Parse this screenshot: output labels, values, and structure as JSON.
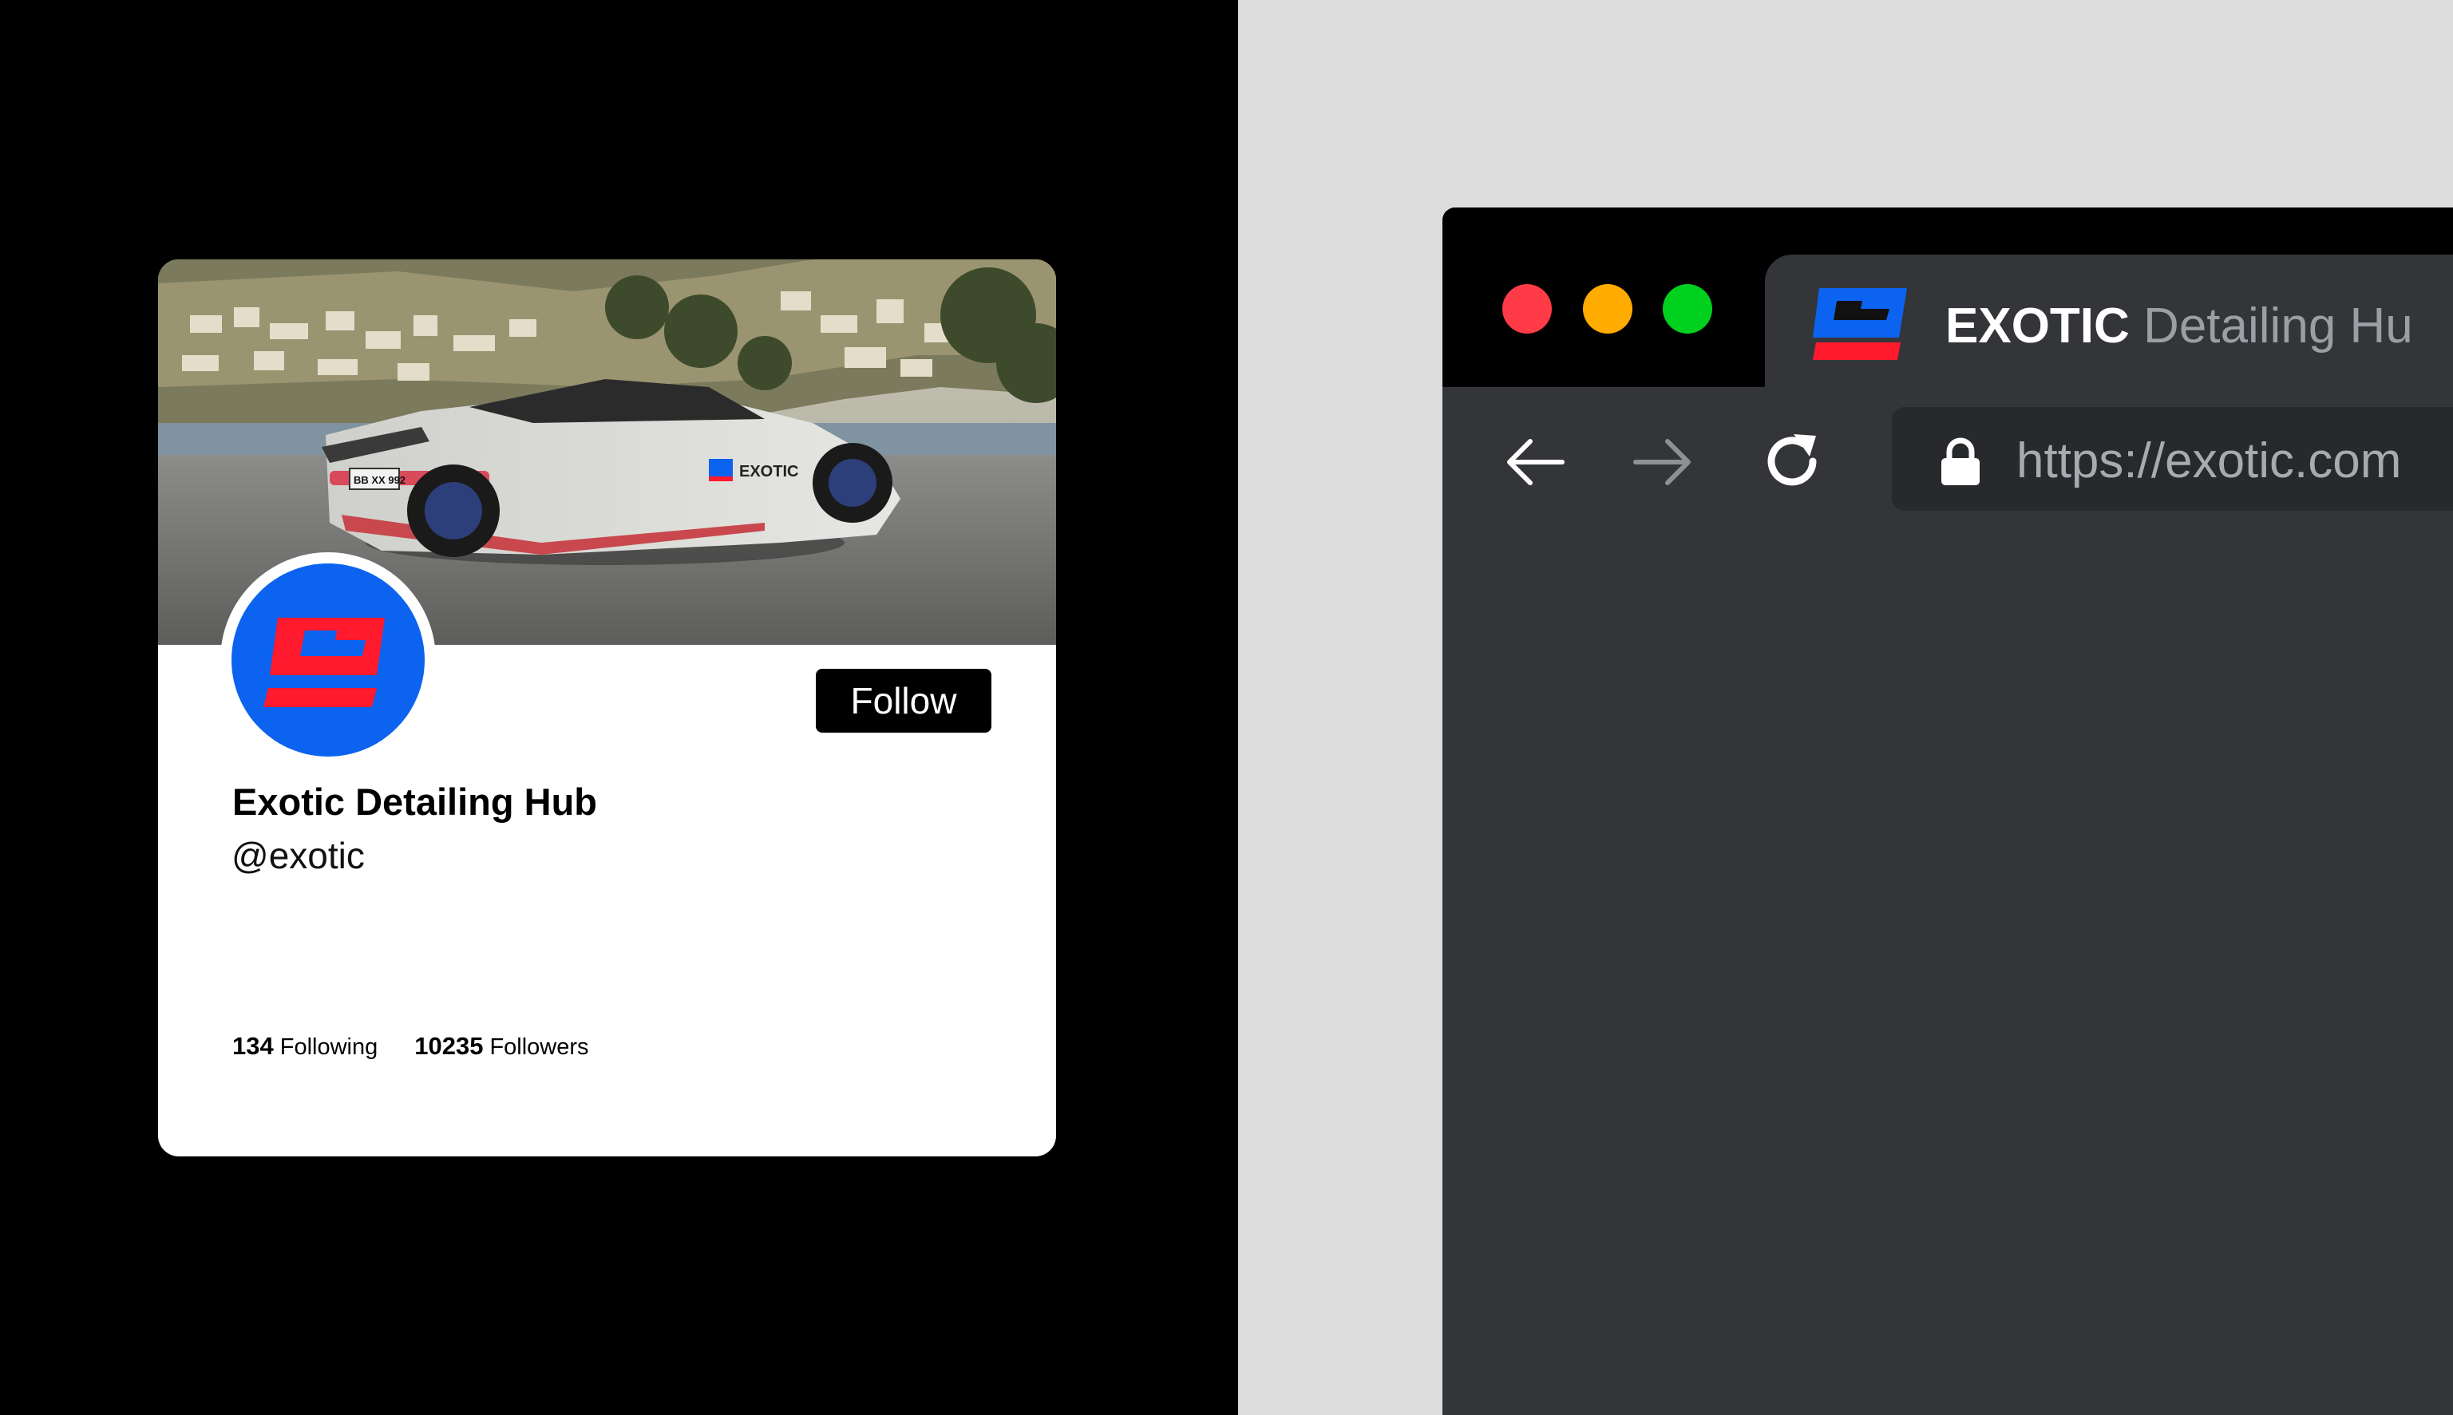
{
  "profile": {
    "display_name": "Exotic Detailing Hub",
    "handle": "@exotic",
    "follow_label": "Follow",
    "following_count": "134",
    "following_label": "Following",
    "followers_count": "10235",
    "followers_label": "Followers",
    "banner_image": "convertible-sports-car-on-coastal-road",
    "banner_car_text": "EXOTIC",
    "banner_plate_text": "BB XX 992"
  },
  "browser": {
    "tab": {
      "brand": "EXOTIC",
      "title_rest": "Detailing Hu"
    },
    "url": "https://exotic.com",
    "controls": [
      "close",
      "minimize",
      "maximize"
    ]
  },
  "colors": {
    "brand_blue": "#0c63f0",
    "brand_red": "#ff1a2e",
    "traffic_red": "#fe3b46",
    "traffic_yellow": "#ffab00",
    "traffic_green": "#00d11f",
    "browser_body": "#333539",
    "page_left_bg": "#000000",
    "page_right_bg": "#dcdcdc"
  },
  "icons": {
    "logo": "exotic-logo-icon",
    "back": "arrow-left-icon",
    "forward": "arrow-right-icon",
    "reload": "reload-icon",
    "lock": "lock-icon"
  }
}
